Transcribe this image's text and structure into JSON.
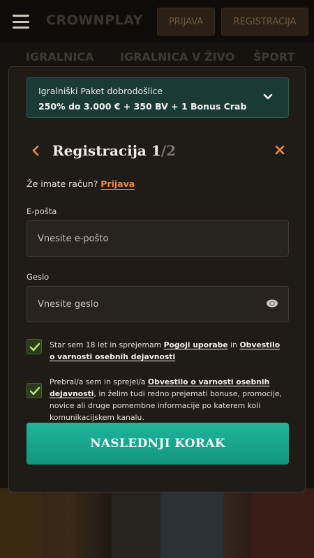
{
  "header": {
    "logo": "CROWNPLAY",
    "login_label": "PRIJAVA",
    "register_label": "REGISTRACIJA"
  },
  "subnav": {
    "items": [
      "IGRALNICA",
      "IGRALNICA V ŽIVO",
      "ŠPORT"
    ]
  },
  "promo": {
    "title": "Igralniški Paket dobrodošlice",
    "offer": "250% do 3.000 € + 350 BV + 1 Bonus Crab"
  },
  "form": {
    "title": "Registracija 1",
    "step_total": "/2",
    "have_account_text": "Že imate račun?",
    "login_link": "Prijava",
    "email_label": "E-pošta",
    "email_placeholder": "Vnesite e-pošto",
    "password_label": "Geslo",
    "password_placeholder": "Vnesite geslo",
    "terms": {
      "text_1": "Star sem 18 let in sprejemam ",
      "link_1": "Pogoji uporabe",
      "text_2": " in ",
      "link_2": "Obvestilo o varnosti osebnih dejavnosti",
      "checked": true
    },
    "marketing": {
      "text_1": "Prebral/a sem in sprejel/a ",
      "link_1": "Obvestilo o varnosti osebnih dejavnosti",
      "text_2": ", in želim tudi redno prejemati bonuse, promocije, novice ali druge pomembne informacije po katerem koli komunikacijskem kanalu.",
      "checked": true
    },
    "next_label": "NASLEDNJI KORAK"
  },
  "colors": {
    "accent_orange": "#f08a38",
    "button_teal": "#1fb59d",
    "promo_bg": "#1a3a36"
  }
}
